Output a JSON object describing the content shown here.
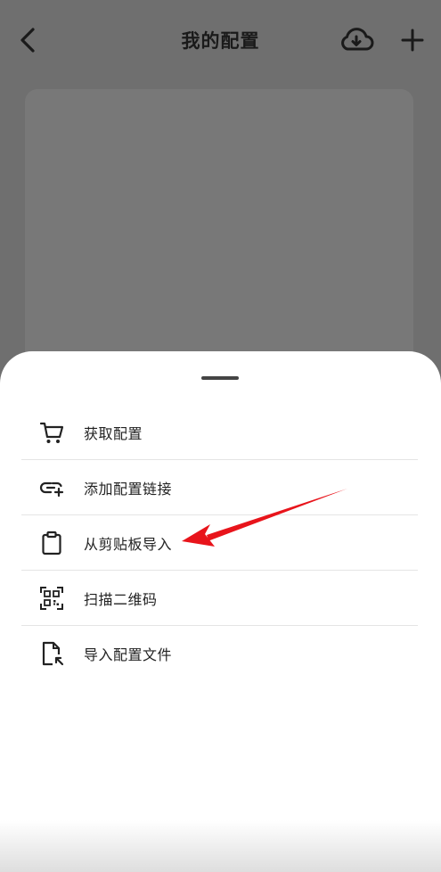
{
  "header": {
    "title": "我的配置",
    "back_icon": "chevron-left-icon",
    "cloud_icon": "cloud-download-icon",
    "add_icon": "plus-icon"
  },
  "sheet": {
    "items": [
      {
        "label": "获取配置",
        "icon": "cart-icon"
      },
      {
        "label": "添加配置链接",
        "icon": "link-add-icon"
      },
      {
        "label": "从剪贴板导入",
        "icon": "clipboard-icon"
      },
      {
        "label": "扫描二维码",
        "icon": "qr-scan-icon"
      },
      {
        "label": "导入配置文件",
        "icon": "file-import-icon"
      }
    ]
  },
  "colors": {
    "overlay": "#6f6f6f",
    "sheet_bg": "#ffffff",
    "annotation_red": "#e8141b"
  }
}
